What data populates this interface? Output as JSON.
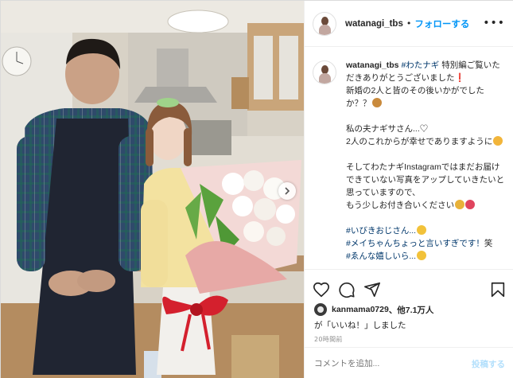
{
  "photo": {
    "alt_icon": "photo",
    "next_icon": "chevron-right-icon"
  },
  "header": {
    "username": "watanagi_tbs",
    "separator": "•",
    "follow_label": "フォローする",
    "more_icon": "more-horizontal-icon"
  },
  "caption": {
    "username": "watanagi_tbs",
    "lines": [
      {
        "parts": [
          {
            "t": "#わたナギ",
            "link": true
          },
          {
            "t": " 特別編ご覧いただきありがとうございました❗"
          }
        ]
      },
      {
        "parts": [
          {
            "t": "新婚の2人と皆のその後いかがでしたか？？"
          }
        ],
        "emoji": "#c98a3c"
      },
      {
        "parts": [
          {
            "t": ""
          }
        ]
      },
      {
        "parts": [
          {
            "t": "私の夫ナギサさん...♡"
          }
        ]
      },
      {
        "parts": [
          {
            "t": "2人のこれからが幸せでありますように"
          }
        ],
        "emoji": "#f2b53a"
      },
      {
        "parts": [
          {
            "t": ""
          }
        ]
      },
      {
        "parts": [
          {
            "t": "そしてわたナギInstagramではまだお届けできていない写真をアップしていきたいと思っていますので、"
          }
        ]
      },
      {
        "parts": [
          {
            "t": "もう少しお付き合いください"
          }
        ],
        "emoji": "#e8b23a",
        "emoji2": "#e0445e"
      },
      {
        "parts": [
          {
            "t": ""
          }
        ]
      },
      {
        "parts": [
          {
            "t": "#いびきおじさん...",
            "link": true
          }
        ],
        "emoji": "#f2c23a"
      },
      {
        "parts": [
          {
            "t": "#メイちゃんちょっと言いすぎです！",
            "link": true
          },
          {
            "t": "笑"
          }
        ]
      },
      {
        "parts": [
          {
            "t": "#ゑんな嬉しいら...",
            "link": true
          }
        ],
        "emoji": "#f2c23a"
      }
    ]
  },
  "actions": {
    "like_icon": "heart-icon",
    "comment_icon": "comment-icon",
    "share_icon": "share-icon",
    "save_icon": "bookmark-icon"
  },
  "likes": {
    "user": "kanmama0729",
    "others": "、他7.1万人",
    "suffix": "が「いいね！」しました"
  },
  "timestamp": "20時間前",
  "comment": {
    "placeholder": "コメントを追加...",
    "post_label": "投稿する"
  },
  "colors": {
    "link": "#00376b",
    "follow": "#0095f6",
    "post_disabled": "#b2dffc",
    "muted": "#8e8e8e"
  }
}
